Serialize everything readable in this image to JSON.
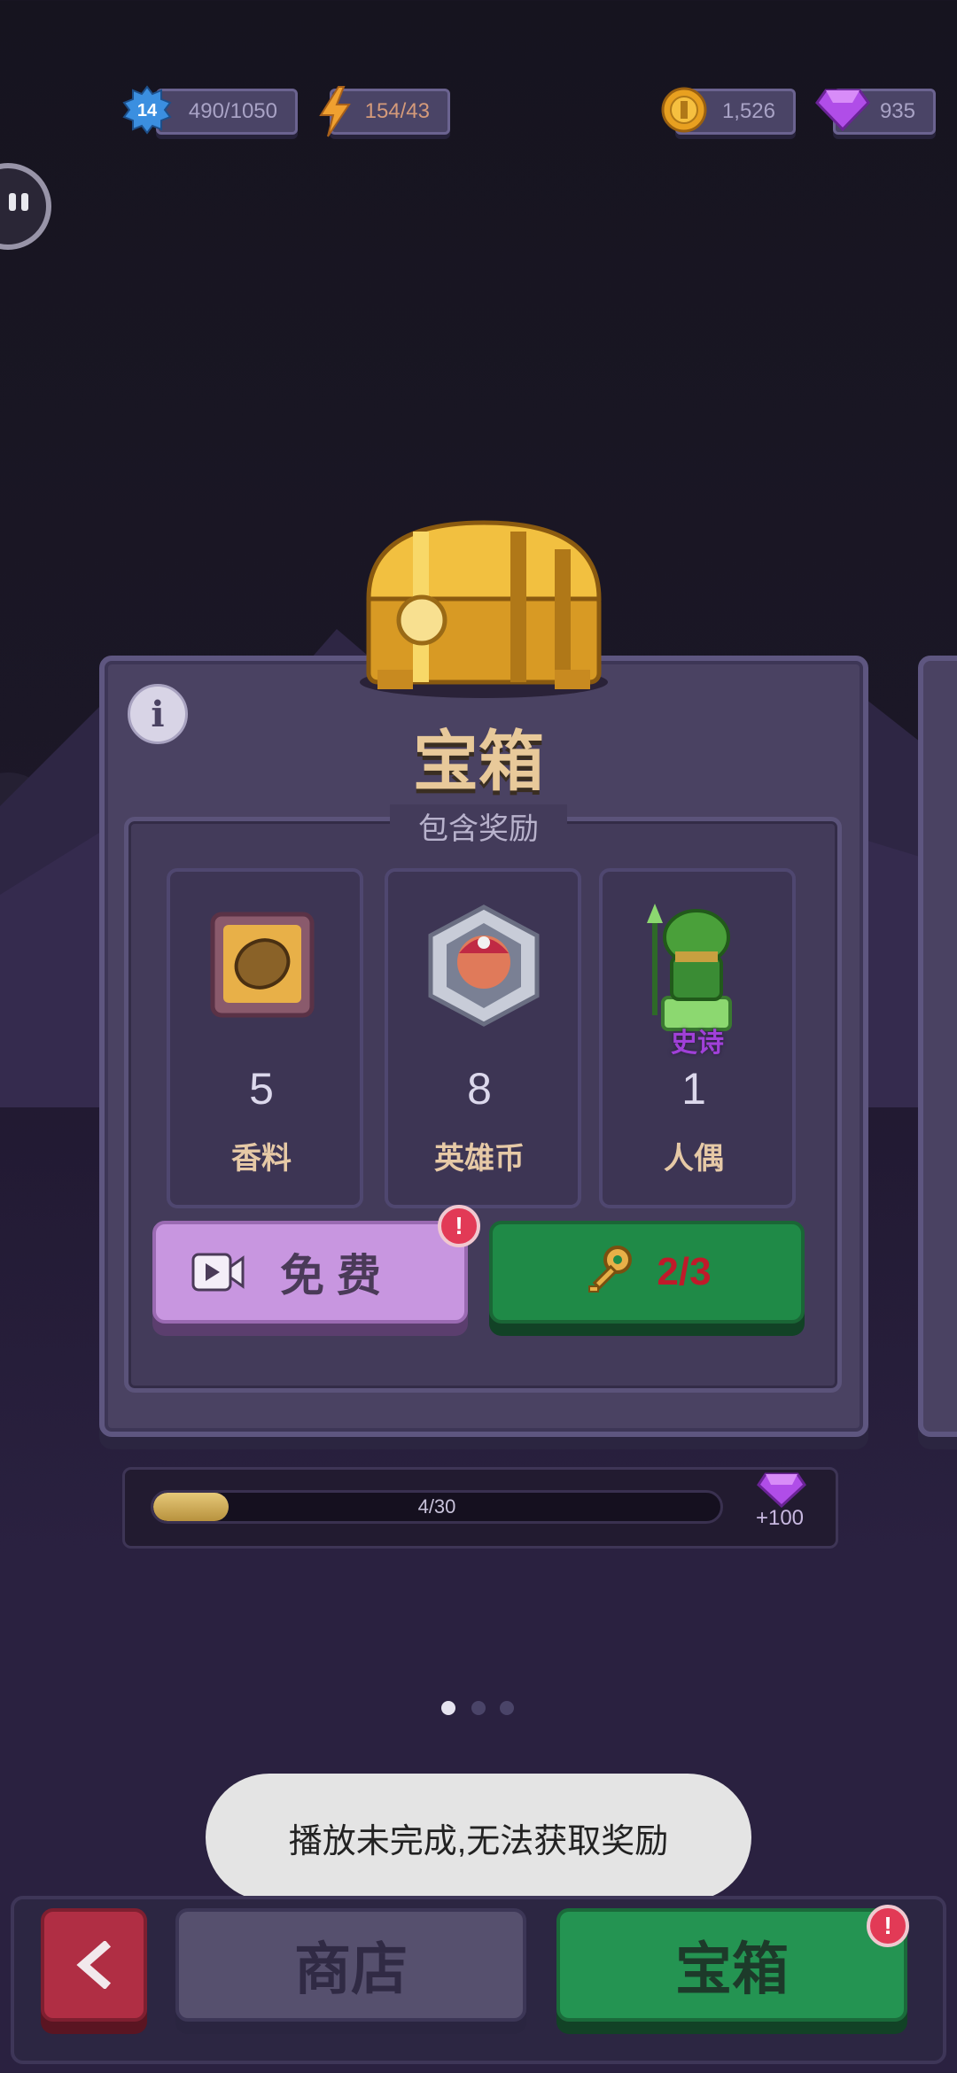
{
  "status_bar": {
    "level": "14",
    "xp": "490/1050",
    "energy": "154/43",
    "coins": "1,526",
    "gems": "935"
  },
  "chest": {
    "title": "宝箱",
    "rewards_heading": "包含奖励",
    "rewards": [
      {
        "count": "5",
        "label": "香料",
        "icon": "spice-seed-icon"
      },
      {
        "count": "8",
        "label": "英雄币",
        "icon": "hero-coin-icon"
      },
      {
        "count": "1",
        "label": "人偶",
        "icon": "frog-figure-icon",
        "rarity": "史诗"
      }
    ],
    "free_button": "免 费",
    "key_progress": "2/3"
  },
  "progress": {
    "text": "4/30",
    "value": 4,
    "max": 30,
    "reward": "+100"
  },
  "toast": "播放未完成,无法获取奖励",
  "bottom_nav": {
    "shop": "商店",
    "chest": "宝箱"
  },
  "colors": {
    "panel": "#4a4262",
    "free_button": "#c896e0",
    "key_button": "#1f8a47",
    "back_button": "#b02e44",
    "alert": "#e23a56"
  }
}
